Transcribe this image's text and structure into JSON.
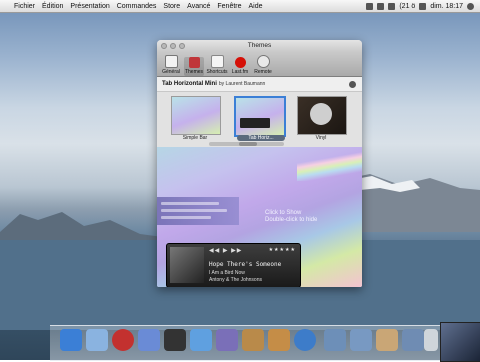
{
  "menubar": {
    "items": [
      "Fichier",
      "Édition",
      "Présentation",
      "Commandes",
      "Store",
      "Avancé",
      "Fenêtre",
      "Aide"
    ],
    "battery": "(21 ö",
    "clock": "dim. 18:17"
  },
  "window": {
    "title": "Themes",
    "toolbar": [
      "Général",
      "Themes",
      "Shortcuts",
      "Last.fm",
      "Remote"
    ],
    "theme_name": "Tab Horizontal Mini",
    "theme_author": "by Laurent Baumann",
    "thumbnails": [
      "Simple Bar",
      "Tab Horiz...",
      "Vinyl"
    ],
    "hint_line1": "Click to Show",
    "hint_line2": "Double-click to hide"
  },
  "player": {
    "controls": "◀◀ ▶ ▶▶",
    "stars": "★★★★★",
    "track": "Hope There's Someone",
    "album": "I Am a Bird Now",
    "artist": "Antony & The Johnsons"
  },
  "colors": {
    "accent_blue": "#3b7fd6",
    "menubar_bg": "#e8e8e8"
  },
  "icons": {
    "toolbar": [
      "general-icon",
      "themes-icon",
      "shortcuts-icon",
      "lastfm-icon",
      "remote-icon"
    ]
  }
}
